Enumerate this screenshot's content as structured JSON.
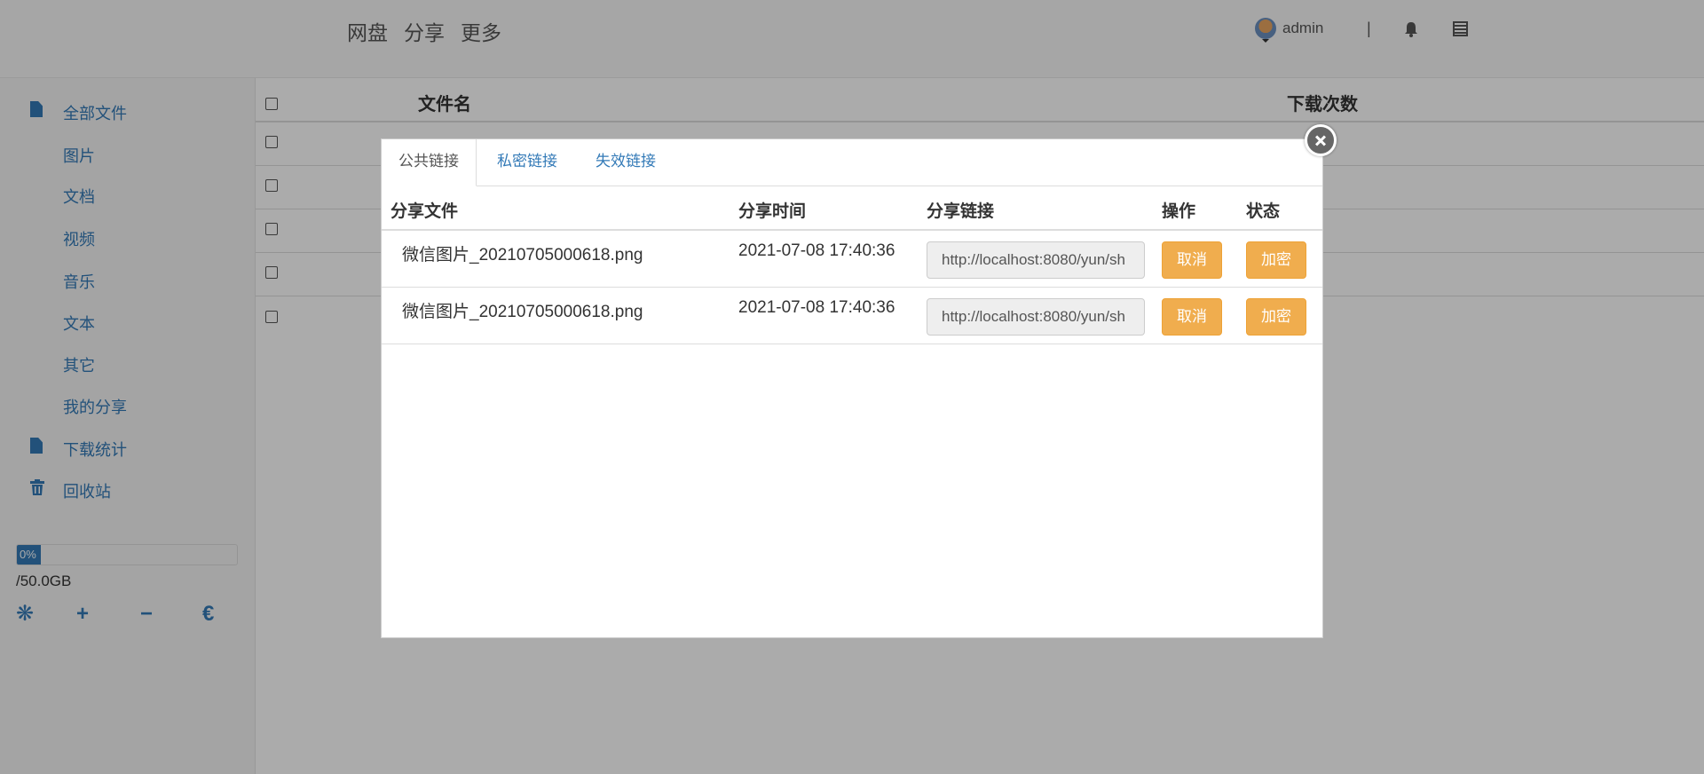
{
  "navbar": {
    "links": [
      "网盘",
      "分享",
      "更多"
    ],
    "user": "admin",
    "separator": "|"
  },
  "sidebar": {
    "items": [
      {
        "label": "全部文件",
        "icon": "file-icon"
      },
      {
        "label": "图片"
      },
      {
        "label": "文档"
      },
      {
        "label": "视频"
      },
      {
        "label": "音乐"
      },
      {
        "label": "文本"
      },
      {
        "label": "其它"
      },
      {
        "label": "我的分享"
      },
      {
        "label": "下载统计",
        "icon": "file-icon"
      },
      {
        "label": "回收站",
        "icon": "trash-icon"
      }
    ],
    "usage_percent_label": "0%",
    "usage_percent": 0,
    "quota": "/50.0GB",
    "tools": [
      "❋",
      "+",
      "−",
      "€"
    ]
  },
  "file_table": {
    "columns": [
      "文件名",
      "下载次数"
    ]
  },
  "modal": {
    "tabs": [
      "公共链接",
      "私密链接",
      "失效链接"
    ],
    "active_tab": 0,
    "columns": [
      "分享文件",
      "分享时间",
      "分享链接",
      "操作",
      "状态"
    ],
    "rows": [
      {
        "file": "微信图片_20210705000618.png",
        "time": "2021-07-08 17:40:36",
        "link": "http://localhost:8080/yun/sh",
        "action": "取消",
        "status": "加密"
      },
      {
        "file": "微信图片_20210705000618.png",
        "time": "2021-07-08 17:40:36",
        "link": "http://localhost:8080/yun/sh",
        "action": "取消",
        "status": "加密"
      }
    ]
  },
  "colors": {
    "primary": "#337ab7",
    "warning": "#f0ad4e"
  }
}
